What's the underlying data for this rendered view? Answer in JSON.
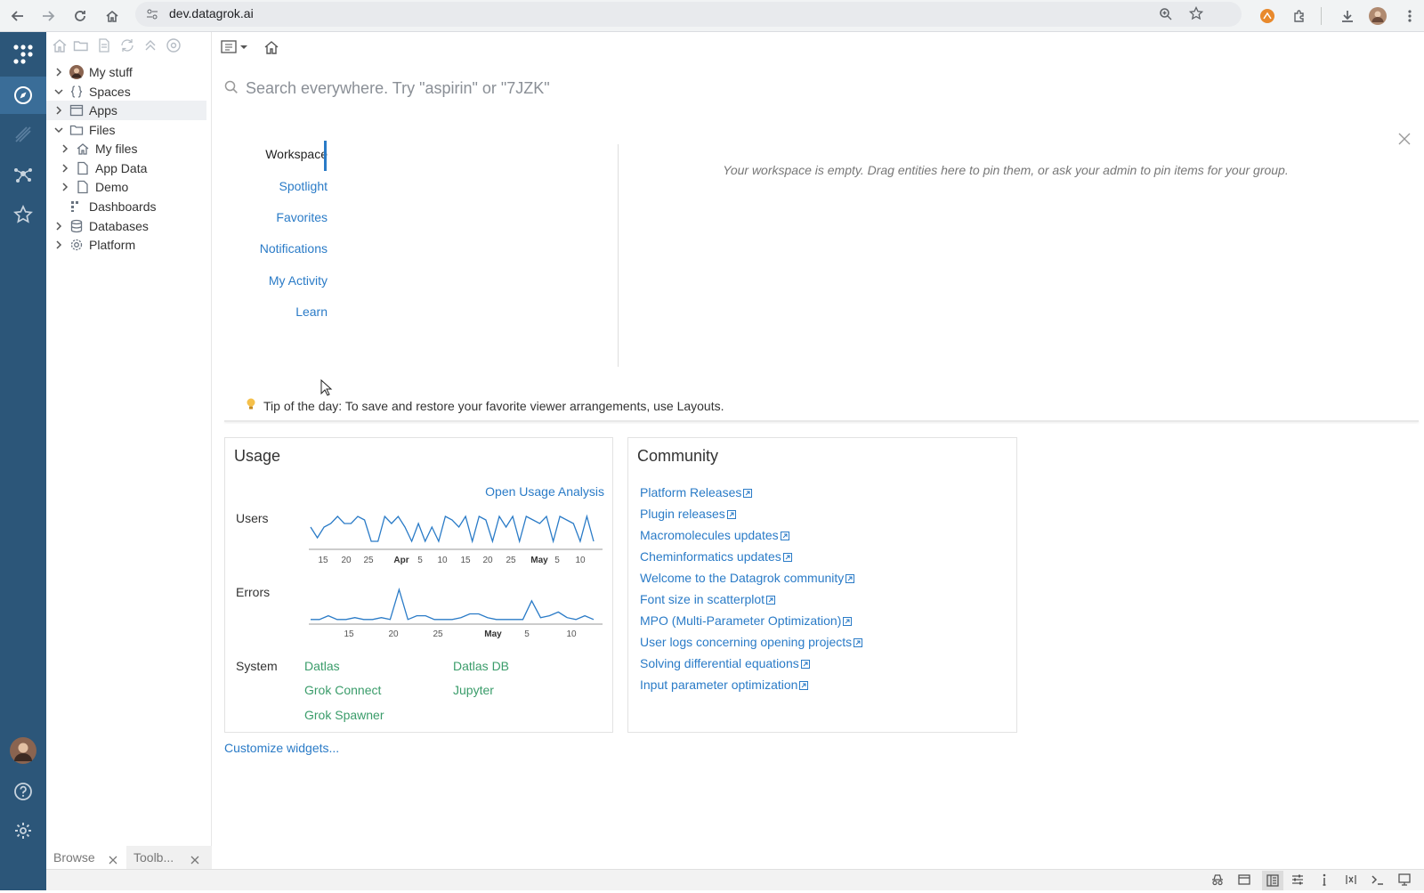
{
  "browser": {
    "url": "dev.datagrok.ai"
  },
  "tree": {
    "items": [
      {
        "label": "My stuff"
      },
      {
        "label": "Spaces"
      },
      {
        "label": "Apps"
      },
      {
        "label": "Files"
      },
      {
        "label": "My files"
      },
      {
        "label": "App Data"
      },
      {
        "label": "Demo"
      },
      {
        "label": "Dashboards"
      },
      {
        "label": "Databases"
      },
      {
        "label": "Platform"
      }
    ]
  },
  "bottom_tabs": [
    {
      "label": "Browse"
    },
    {
      "label": "Toolb..."
    }
  ],
  "search": {
    "placeholder": "Search everywhere. Try \"aspirin\" or \"7JZK\""
  },
  "nav": {
    "items": [
      {
        "label": "Workspace",
        "active": true
      },
      {
        "label": "Spotlight"
      },
      {
        "label": "Favorites"
      },
      {
        "label": "Notifications"
      },
      {
        "label": "My Activity"
      },
      {
        "label": "Learn"
      }
    ]
  },
  "workspace": {
    "empty_message": "Your workspace is empty. Drag entities here to pin them, or ask your admin to pin items for your group."
  },
  "tip": {
    "text": "Tip of the day: To save and restore your favorite viewer arrangements, use Layouts."
  },
  "usage": {
    "title": "Usage",
    "open_link": "Open Usage Analysis",
    "users_label": "Users",
    "errors_label": "Errors",
    "system_label": "System",
    "users_ticks": [
      "15",
      "20",
      "25",
      "Apr",
      "5",
      "10",
      "15",
      "20",
      "25",
      "May",
      "5",
      "10"
    ],
    "errors_ticks": [
      "15",
      "20",
      "25",
      "May",
      "5",
      "10"
    ],
    "system_links": [
      "Datlas",
      "Datlas DB",
      "Grok Connect",
      "Jupyter",
      "Grok Spawner"
    ]
  },
  "community": {
    "title": "Community",
    "links": [
      "Platform Releases",
      "Plugin releases",
      "Macromolecules updates",
      "Cheminformatics updates",
      "Welcome to the Datagrok community",
      "Font size in scatterplot",
      "MPO (Multi-Parameter Optimization)",
      "User logs concerning opening projects",
      "Solving differential equations",
      "Input parameter optimization"
    ]
  },
  "customize": "Customize widgets...",
  "chart_data": [
    {
      "type": "line",
      "series": [
        {
          "values": [
            6,
            3,
            6,
            7,
            9,
            7,
            7,
            9,
            8,
            2,
            2,
            9,
            7,
            9,
            6,
            2,
            7,
            2,
            6,
            2,
            9,
            8,
            6,
            9,
            2,
            9,
            8,
            2,
            9,
            6,
            9,
            2,
            9,
            8,
            7,
            9,
            2,
            9,
            8,
            7,
            2,
            9,
            2
          ]
        }
      ],
      "ylim": [
        0,
        10
      ],
      "grid": false
    },
    {
      "type": "line",
      "series": [
        {
          "values": [
            1,
            1,
            2,
            1,
            1,
            1.5,
            1,
            1,
            1.5,
            1,
            9,
            1,
            2,
            2,
            1,
            1,
            1,
            1.5,
            2.5,
            2.5,
            1.5,
            1,
            1,
            1,
            1,
            6,
            1.5,
            2,
            3,
            1.5,
            1,
            2,
            1
          ]
        }
      ],
      "ylim": [
        0,
        10
      ],
      "grid": false
    }
  ]
}
